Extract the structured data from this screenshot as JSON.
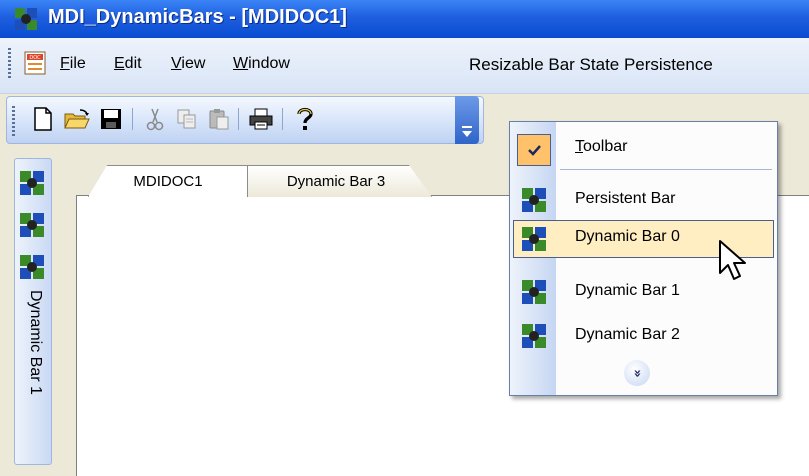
{
  "window": {
    "title": "MDI_DynamicBars - [MDIDOC1]"
  },
  "menubar": {
    "items": [
      {
        "label": "File",
        "mnemonic": "F",
        "rest": "ile"
      },
      {
        "label": "Edit",
        "mnemonic": "E",
        "rest": "dit"
      },
      {
        "label": "View",
        "mnemonic": "V",
        "rest": "iew"
      },
      {
        "label": "Window",
        "mnemonic": "W",
        "rest": "indow"
      }
    ],
    "caption": "Resizable Bar State Persistence"
  },
  "toolbar": {
    "buttons": [
      "new-icon",
      "open-icon",
      "save-icon",
      "cut-icon",
      "copy-icon",
      "paste-icon",
      "print-icon",
      "help-icon"
    ]
  },
  "left_dock": {
    "bar_label": "Dynamic Bar 1"
  },
  "tabs": [
    {
      "label": "MDIDOC1"
    },
    {
      "label": "Dynamic Bar 3"
    }
  ],
  "popup_menu": {
    "items": [
      {
        "label": "Toolbar",
        "mnemonic": "T",
        "rest": "oolbar",
        "checked": true
      },
      {
        "label": "Persistent Bar"
      },
      {
        "label": "Dynamic Bar 0",
        "highlighted": true
      },
      {
        "label": "Dynamic Bar 1"
      },
      {
        "label": "Dynamic Bar 2"
      }
    ],
    "more_glyph": "»"
  }
}
